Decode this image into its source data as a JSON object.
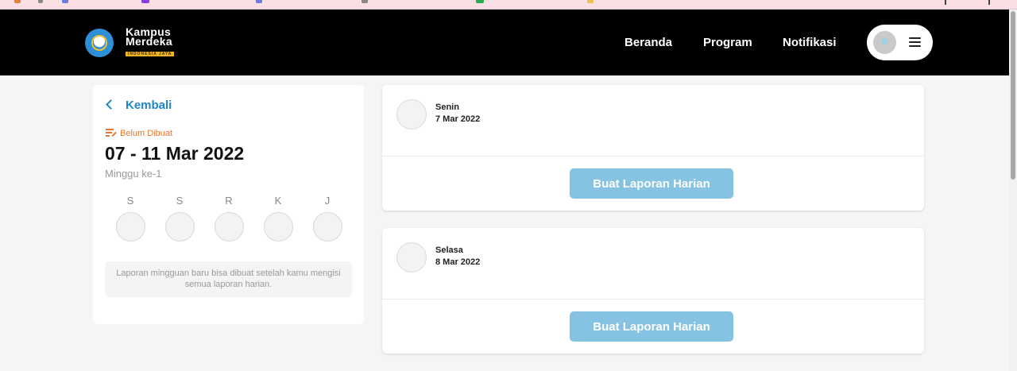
{
  "nav": {
    "logo": {
      "line1": "Kampus",
      "line2": "Merdeka",
      "tag": "INDONESIA JAYA"
    },
    "links": [
      "Beranda",
      "Program",
      "Notifikasi"
    ]
  },
  "left_panel": {
    "back_label": "Kembali",
    "status_label": "Belum Dibuat",
    "week_range": "07 - 11 Mar 2022",
    "week_number": "Minggu ke-1",
    "days": [
      "S",
      "S",
      "R",
      "K",
      "J"
    ],
    "info_text": "Laporan mingguan baru bisa dibuat setelah kamu mengisi semua laporan harian."
  },
  "day_cards": [
    {
      "day": "Senin",
      "date": "7 Mar 2022",
      "button_label": "Buat Laporan Harian"
    },
    {
      "day": "Selasa",
      "date": "8 Mar 2022",
      "button_label": "Buat Laporan Harian"
    }
  ],
  "colors": {
    "accent": "#1f86c6",
    "status": "#e8772e",
    "button": "#86c3e3",
    "nav_bg": "#000000"
  }
}
